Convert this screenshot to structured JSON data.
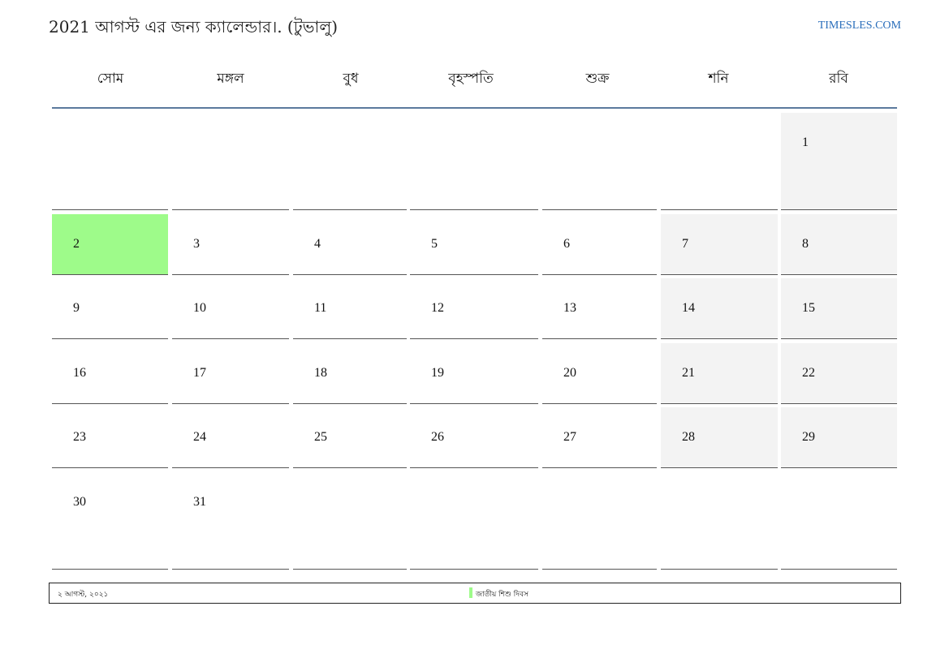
{
  "header": {
    "title": "2021 আগস্ট এর জন্য ক্যালেন্ডার।. (টুভালু)",
    "site": "TIMESLES.COM"
  },
  "colors": {
    "link": "#2a6ebb",
    "header_rule": "#5b7a9d",
    "weekend_fill": "#f3f3f3",
    "holiday_fill": "#9efb8a"
  },
  "weekdays": [
    "সোম",
    "মঙ্গল",
    "বুধ",
    "বৃহস্পতি",
    "শুক্র",
    "শনি",
    "রবি"
  ],
  "calendar": {
    "weeks": [
      [
        "",
        "",
        "",
        "",
        "",
        "",
        "1"
      ],
      [
        "2",
        "3",
        "4",
        "5",
        "6",
        "7",
        "8"
      ],
      [
        "9",
        "10",
        "11",
        "12",
        "13",
        "14",
        "15"
      ],
      [
        "16",
        "17",
        "18",
        "19",
        "20",
        "21",
        "22"
      ],
      [
        "23",
        "24",
        "25",
        "26",
        "27",
        "28",
        "29"
      ],
      [
        "30",
        "31",
        "",
        "",
        "",
        "",
        ""
      ]
    ],
    "highlighted_days": [
      "2"
    ]
  },
  "holidays": [
    {
      "date": "২ আগস্ট, ২০২১",
      "name": "জাতীয় শিশু দিবস",
      "color": "#9efb8a"
    }
  ]
}
